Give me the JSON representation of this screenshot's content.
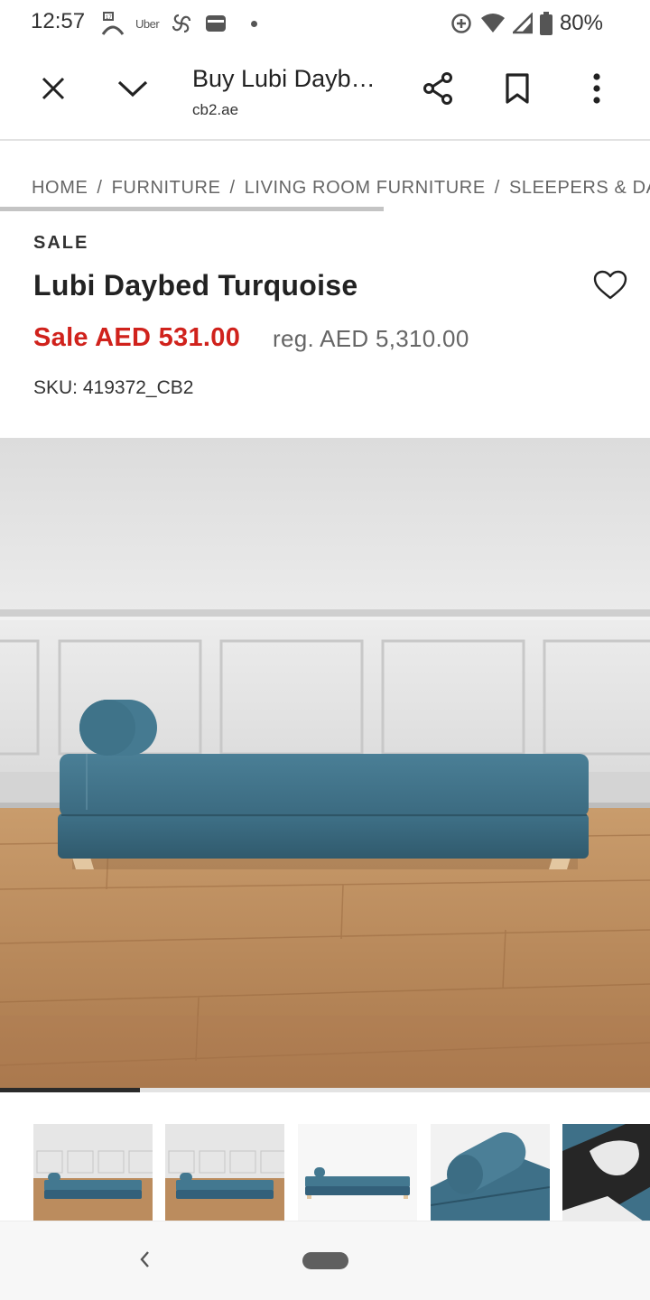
{
  "status_bar": {
    "time": "12:57",
    "uber_label": "Uber",
    "battery_percent": "80%",
    "icons": [
      "google-fit-icon",
      "uber-icon",
      "pinwheel-icon",
      "wallet-icon",
      "notification-dot",
      "data-saver-icon",
      "wifi-icon",
      "signal-icon",
      "battery-icon"
    ]
  },
  "browser": {
    "title": "Buy Lubi Daybed Turquoise",
    "domain": "cb2.ae",
    "icons": [
      "close-icon",
      "chevron-down-icon",
      "share-icon",
      "bookmark-icon",
      "more-vert-icon"
    ]
  },
  "breadcrumb": {
    "items": [
      "HOME",
      "FURNITURE",
      "LIVING ROOM FURNITURE",
      "SLEEPERS & DAYBEDS"
    ],
    "separator": "/",
    "scroll_fraction": 0.59
  },
  "product": {
    "badge": "SALE",
    "name": "Lubi Daybed Turquoise",
    "sale_price": "Sale AED 531.00",
    "regular_price": "reg. AED 5,310.00",
    "sku": "SKU: 419372_CB2"
  },
  "gallery": {
    "position_fraction": 0.215,
    "thumbnail_count": 5
  },
  "colors": {
    "sale_red": "#d0221c",
    "sofa_teal": "#3d6e84",
    "floor_wood": "#b98a5c",
    "wall_gray": "#e6e6e6"
  }
}
